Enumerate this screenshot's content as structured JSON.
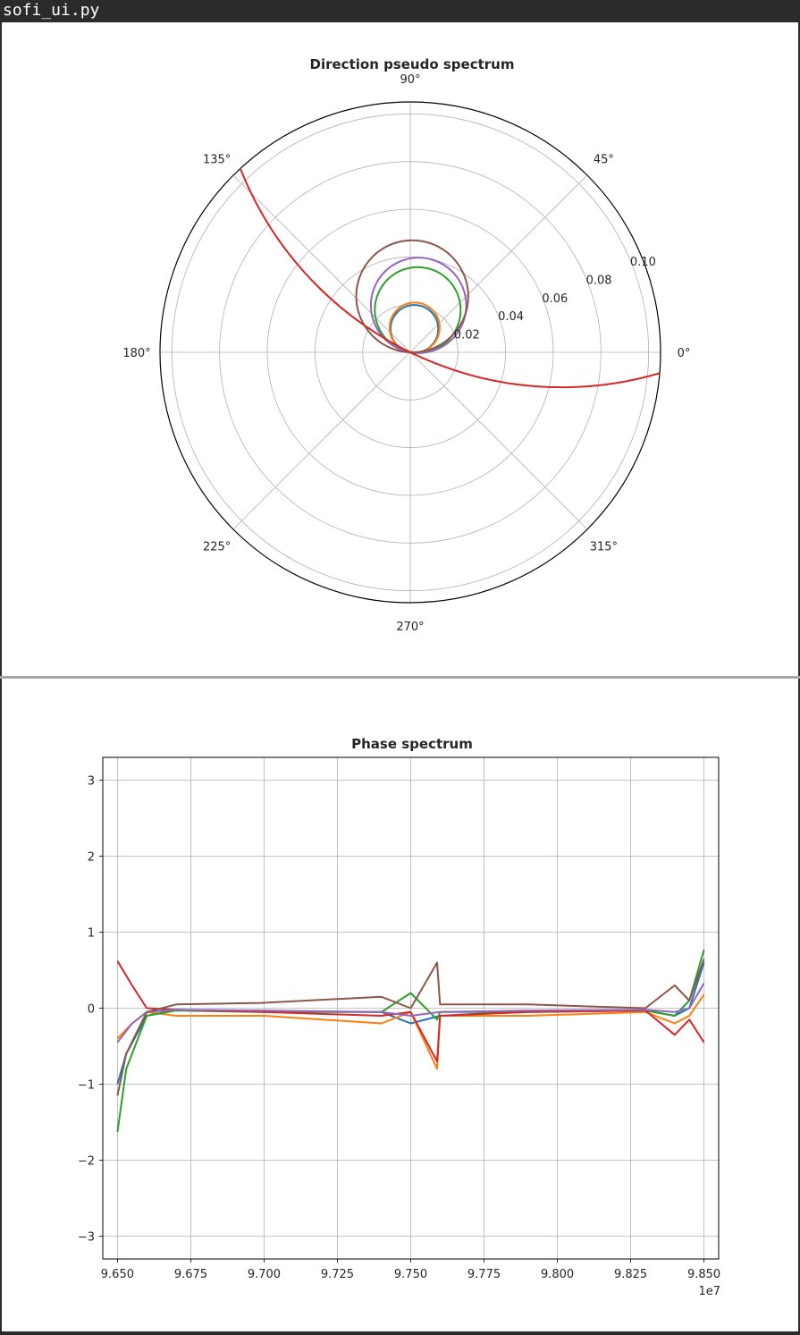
{
  "window": {
    "title": "sofi_ui.py"
  },
  "polar_chart": {
    "title": "Direction pseudo spectrum",
    "angle_labels": [
      "0°",
      "45°",
      "90°",
      "135°",
      "180°",
      "225°",
      "270°",
      "315°"
    ],
    "radial_ticks": [
      "0.02",
      "0.04",
      "0.06",
      "0.08",
      "0.10"
    ],
    "rmax": 0.105,
    "series_colors": [
      "#1f77b4",
      "#ff7f0e",
      "#2ca02c",
      "#d62728",
      "#9467bd",
      "#8c564b"
    ]
  },
  "phase_chart": {
    "title": "Phase spectrum",
    "y_ticks": [
      "3",
      "2",
      "1",
      "0",
      "−1",
      "−2",
      "−3"
    ],
    "x_ticks": [
      "9.650",
      "9.675",
      "9.700",
      "9.725",
      "9.750",
      "9.775",
      "9.800",
      "9.825",
      "9.850"
    ],
    "x_offset_label": "1e7"
  },
  "chart_data": [
    {
      "type": "polar",
      "title": "Direction pseudo spectrum",
      "theta_ticks_deg": [
        0,
        45,
        90,
        135,
        180,
        225,
        270,
        315
      ],
      "r_ticks": [
        0.02,
        0.04,
        0.06,
        0.08,
        0.1
      ],
      "rlim": [
        0,
        0.105
      ],
      "grid": true,
      "series": [
        {
          "color": "#1f77b4",
          "shape": "circle through origin",
          "max_r": 0.02,
          "peak_deg": 80
        },
        {
          "color": "#ff7f0e",
          "shape": "circle through origin",
          "max_r": 0.021,
          "peak_deg": 80
        },
        {
          "color": "#2ca02c",
          "shape": "circle through origin",
          "max_r": 0.036,
          "peak_deg": 80
        },
        {
          "color": "#9467bd",
          "shape": "circle through origin",
          "max_r": 0.04,
          "peak_deg": 80
        },
        {
          "color": "#8c564b",
          "shape": "circle through origin",
          "max_r": 0.047,
          "peak_deg": 88
        },
        {
          "color": "#d62728",
          "shape": "circle through origin",
          "max_r": 0.29,
          "peak_deg": 64
        }
      ]
    },
    {
      "type": "line",
      "title": "Phase spectrum",
      "xlim": [
        96450000,
        98550000
      ],
      "ylim": [
        -3.3,
        3.3
      ],
      "x_tick_values": [
        96500000,
        96750000,
        97000000,
        97250000,
        97500000,
        97750000,
        98000000,
        98250000,
        98500000
      ],
      "y_tick_values": [
        3,
        2,
        1,
        0,
        -1,
        -2,
        -3
      ],
      "grid": true,
      "series": [
        {
          "color": "#1f77b4",
          "x": [
            96500000,
            96530000,
            96600000,
            96700000,
            97000000,
            97400000,
            97500000,
            97600000,
            97900000,
            98300000,
            98400000,
            98450000,
            98500000
          ],
          "y": [
            -1.0,
            -0.6,
            -0.1,
            -0.02,
            -0.04,
            -0.05,
            -0.2,
            -0.1,
            -0.04,
            -0.03,
            -0.1,
            0.0,
            0.6
          ]
        },
        {
          "color": "#ff7f0e",
          "x": [
            96500000,
            96550000,
            96600000,
            96700000,
            97000000,
            97400000,
            97500000,
            97590000,
            97600000,
            97900000,
            98300000,
            98400000,
            98450000,
            98500000
          ],
          "y": [
            -0.4,
            -0.2,
            -0.05,
            -0.1,
            -0.1,
            -0.2,
            -0.05,
            -0.8,
            -0.1,
            -0.1,
            -0.05,
            -0.2,
            -0.1,
            0.18
          ]
        },
        {
          "color": "#2ca02c",
          "x": [
            96500000,
            96530000,
            96600000,
            96700000,
            97000000,
            97400000,
            97500000,
            97590000,
            97600000,
            97900000,
            98300000,
            98400000,
            98450000,
            98500000
          ],
          "y": [
            -1.63,
            -0.8,
            -0.1,
            -0.03,
            -0.05,
            -0.05,
            0.2,
            -0.15,
            -0.05,
            -0.05,
            -0.03,
            -0.1,
            0.1,
            0.77
          ]
        },
        {
          "color": "#d62728",
          "x": [
            96500000,
            96550000,
            96600000,
            96700000,
            97000000,
            97400000,
            97500000,
            97590000,
            97600000,
            97900000,
            98300000,
            98400000,
            98450000,
            98500000
          ],
          "y": [
            0.62,
            0.3,
            0.0,
            -0.02,
            -0.05,
            -0.1,
            -0.05,
            -0.7,
            -0.1,
            -0.05,
            -0.03,
            -0.35,
            -0.15,
            -0.45
          ]
        },
        {
          "color": "#9467bd",
          "x": [
            96500000,
            96550000,
            96600000,
            96700000,
            97000000,
            97400000,
            97500000,
            97600000,
            97900000,
            98300000,
            98400000,
            98450000,
            98500000
          ],
          "y": [
            -0.45,
            -0.2,
            -0.05,
            -0.02,
            -0.03,
            -0.05,
            -0.1,
            -0.05,
            -0.03,
            -0.02,
            -0.05,
            0.0,
            0.33
          ]
        },
        {
          "color": "#8c564b",
          "x": [
            96500000,
            96530000,
            96600000,
            96700000,
            96990000,
            97400000,
            97500000,
            97590000,
            97600000,
            97900000,
            98300000,
            98400000,
            98450000,
            98500000
          ],
          "y": [
            -1.15,
            -0.6,
            -0.05,
            0.05,
            0.07,
            0.15,
            0.0,
            0.6,
            0.05,
            0.05,
            0.0,
            0.3,
            0.1,
            0.65
          ]
        }
      ]
    }
  ]
}
